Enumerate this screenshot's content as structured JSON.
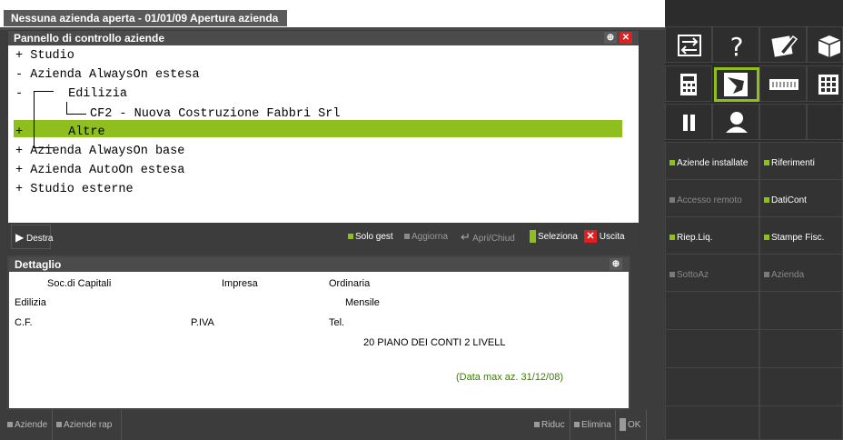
{
  "titlebar": {
    "title": "Nessuna azienda aperta - 01/01/09  Apertura azienda"
  },
  "control_panel": {
    "title": "Pannello di controllo aziende",
    "tree": [
      {
        "prefix": "+",
        "label": "Studio"
      },
      {
        "prefix": "-",
        "label": "Azienda AlwaysOn estesa"
      },
      {
        "prefix": "-",
        "label": "Edilizia"
      },
      {
        "prefix": "",
        "label": "CF2 - Nuova Costruzione Fabbri Srl",
        "selected": true
      },
      {
        "prefix": "+",
        "label": "Altre"
      },
      {
        "prefix": "+",
        "label": "Azienda AlwaysOn base"
      },
      {
        "prefix": "+",
        "label": "Azienda AutoOn estesa"
      },
      {
        "prefix": "+",
        "label": "Studio esterne"
      }
    ],
    "toolbar": {
      "destra": "Destra",
      "solo_gest": "Solo gest",
      "aggiorna": "Aggiorna",
      "apri_chiud": "Apri/Chiud",
      "seleziona": "Seleziona",
      "uscita": "Uscita"
    }
  },
  "dettaglio": {
    "title": "Dettaglio",
    "tipo": "Soc.di Capitali",
    "impresa": "Impresa",
    "contabilita": "Ordinaria",
    "attivita": "Edilizia",
    "periodicita": "Mensile",
    "cf": "C.F.",
    "piva": "P.IVA",
    "tel": "Tel.",
    "piano": "20  PIANO DEI CONTI 2 LIVELL",
    "data_max": "(Data max az. 31/12/08)"
  },
  "bottom_bar": {
    "aziende": "Aziende",
    "aziende_rap": "Aziende rap",
    "riduc": "Riduc",
    "elimina": "Elimina",
    "ok": "OK"
  },
  "right_panel": {
    "icons": [
      "swap-arrows-icon",
      "help-icon",
      "edit-pencil-icon",
      "cube-icon",
      "calculator-icon",
      "hand-icon",
      "keyboard-icon",
      "grid-icon",
      "pause-icon",
      "user-icon"
    ],
    "buttons": {
      "aziende_installate": "Aziende installate",
      "riferimenti": "Riferimenti",
      "accesso_remoto": "Accesso remoto",
      "dati_cont": "DatiCont",
      "riep_liq": "Riep.Liq.",
      "stampe_fisc": "Stampe Fisc.",
      "sotto_az": "SottoAz",
      "azienda": "Azienda"
    }
  },
  "colors": {
    "selection": "#8fbf1f",
    "accent_green": "#8fbf1f",
    "close_red": "#e02020",
    "data_max_text": "#3b7d00"
  }
}
